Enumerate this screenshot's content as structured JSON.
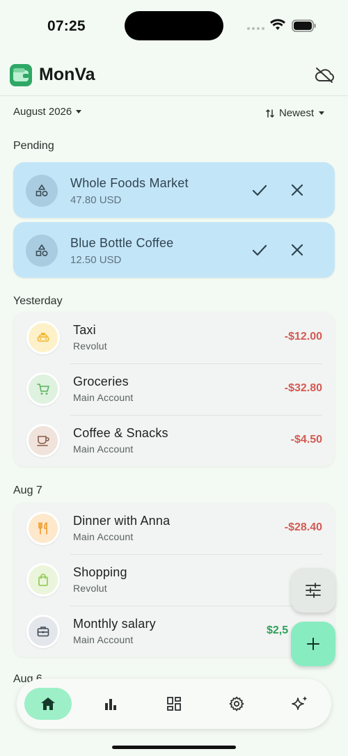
{
  "status_bar": {
    "time": "07:25"
  },
  "app": {
    "title": "MonVa"
  },
  "filters": {
    "month": "August 2026",
    "sort": "Newest"
  },
  "pending": {
    "label": "Pending",
    "items": [
      {
        "name": "Whole Foods Market",
        "amount": "47.80 USD"
      },
      {
        "name": "Blue Bottle Coffee",
        "amount": "12.50 USD"
      }
    ]
  },
  "groups": [
    {
      "label": "Yesterday",
      "items": [
        {
          "name": "Taxi",
          "account": "Revolut",
          "amount": "-$12.00",
          "icon": "taxi-icon",
          "icon_color": "#f2b731",
          "icon_bg": "#fdf1c9"
        },
        {
          "name": "Groceries",
          "account": "Main Account",
          "amount": "-$32.80",
          "icon": "cart-icon",
          "icon_color": "#56b45e",
          "icon_bg": "#dff1df"
        },
        {
          "name": "Coffee & Snacks",
          "account": "Main Account",
          "amount": "-$4.50",
          "icon": "coffee-cup-icon",
          "icon_color": "#8a5a48",
          "icon_bg": "#efe3dc"
        }
      ]
    },
    {
      "label": "Aug 7",
      "items": [
        {
          "name": "Dinner with Anna",
          "account": "Main Account",
          "amount": "-$28.40",
          "icon": "restaurant-icon",
          "icon_color": "#f09a2a",
          "icon_bg": "#fde8cc"
        },
        {
          "name": "Shopping",
          "account": "Revolut",
          "amount": "-$",
          "icon": "shopping-bag-icon",
          "icon_color": "#8cc84b",
          "icon_bg": "#ebf5dc"
        },
        {
          "name": "Monthly salary",
          "account": "Main Account",
          "amount": "$2,5",
          "icon": "briefcase-icon",
          "icon_color": "#3f4a55",
          "icon_bg": "#e3e6ea"
        }
      ]
    }
  ],
  "peek_label": "Aug 6",
  "colors": {
    "accent": "#9defc7",
    "negative": "#d45a54",
    "positive": "#2f9e5a",
    "pending_bg": "#c3e5f8"
  }
}
